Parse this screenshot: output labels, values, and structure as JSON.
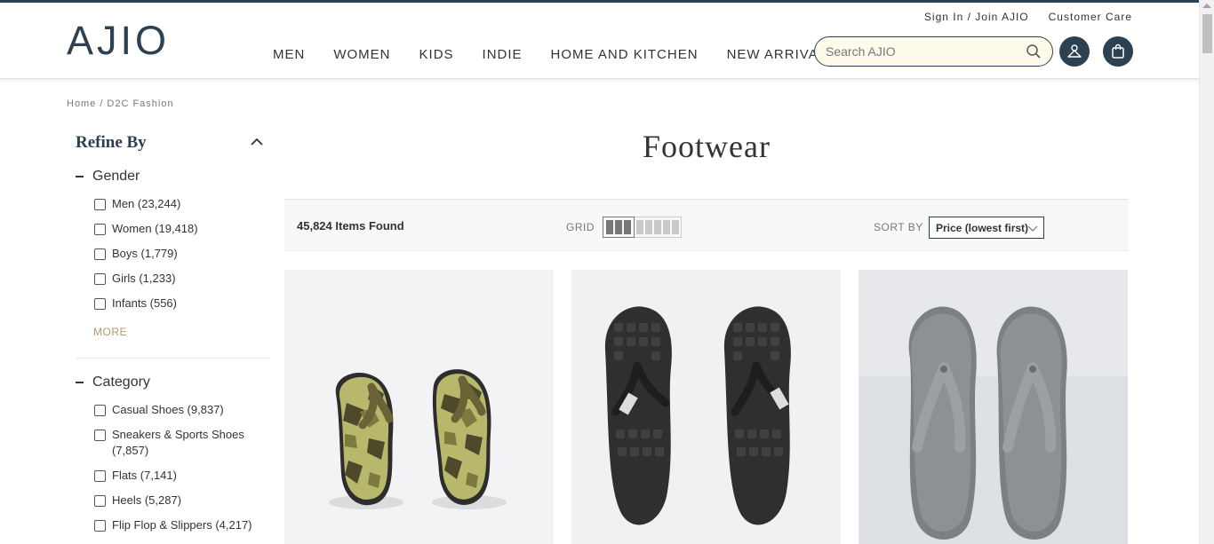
{
  "header": {
    "logo": "AJIO",
    "top_links": {
      "signin": "Sign In / Join AJIO",
      "care": "Customer Care"
    },
    "nav": [
      "MEN",
      "WOMEN",
      "KIDS",
      "INDIE",
      "HOME AND KITCHEN",
      "NEW ARRIVALS"
    ],
    "search_placeholder": "Search AJIO"
  },
  "breadcrumb": {
    "home": "Home",
    "separator": "/",
    "current": "D2C Fashion"
  },
  "sidebar": {
    "title": "Refine By",
    "gender": {
      "title": "Gender",
      "options": [
        "Men (23,244)",
        "Women (19,418)",
        "Boys (1,779)",
        "Girls (1,233)",
        "Infants (556)"
      ],
      "more": "MORE"
    },
    "category": {
      "title": "Category",
      "options": [
        "Casual Shoes (9,837)",
        "Sneakers & Sports Shoes (7,857)",
        "Flats (7,141)",
        "Heels (5,287)",
        "Flip Flop & Slippers (4,217)"
      ]
    }
  },
  "main": {
    "title": "Footwear",
    "items_found": "45,824 Items Found",
    "grid_label": "GRID",
    "sort_label": "SORT BY",
    "sort_value": "Price (lowest first)"
  },
  "products": [
    {
      "icon": "camo-flip-flops-image",
      "color": "#c9c77a"
    },
    {
      "icon": "black-flip-flops-image",
      "color": "#3a3a3a"
    },
    {
      "icon": "grey-flip-flops-image",
      "color": "#8c9091"
    }
  ],
  "colors": {
    "brand": "#2c4152",
    "accent": "#b19975",
    "search_bg": "#fffbea"
  }
}
